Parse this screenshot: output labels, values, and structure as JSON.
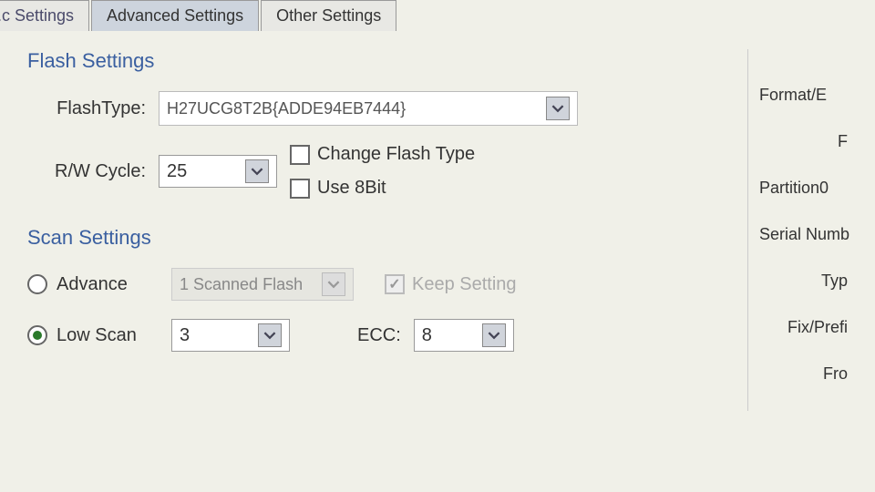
{
  "tabs": {
    "partial_left": "...c Settings",
    "advanced": "Advanced Settings",
    "other": "Other Settings"
  },
  "flash_settings": {
    "title": "Flash Settings",
    "flashtype_label": "FlashType:",
    "flashtype_value": "H27UCG8T2B{ADDE94EB7444}",
    "rw_cycle_label": "R/W Cycle:",
    "rw_cycle_value": "25",
    "change_flash_label": "Change Flash Type",
    "use_8bit_label": "Use 8Bit"
  },
  "scan_settings": {
    "title": "Scan Settings",
    "advance_label": "Advance",
    "scanned_flash_value": "1 Scanned Flash",
    "keep_setting_label": "Keep Setting",
    "low_scan_label": "Low Scan",
    "low_scan_value": "3",
    "ecc_label": "ECC:",
    "ecc_value": "8"
  },
  "side": {
    "format": "Format/E",
    "f": "F",
    "partition0": "Partition0",
    "serial_num": "Serial Numb",
    "typ": "Typ",
    "fix_prefix": "Fix/Prefi",
    "fro": "Fro"
  }
}
